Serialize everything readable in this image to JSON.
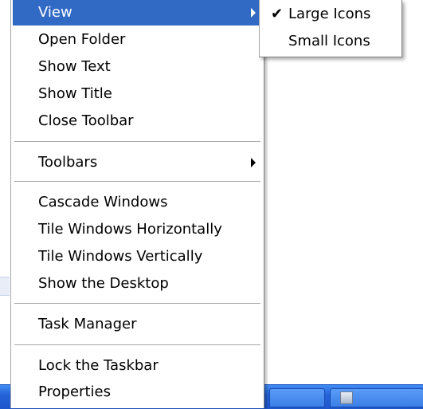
{
  "menu": {
    "items": [
      {
        "label": "View",
        "has_submenu": true,
        "selected": true
      },
      {
        "label": "Open Folder"
      },
      {
        "label": "Show Text"
      },
      {
        "label": "Show Title"
      },
      {
        "label": "Close Toolbar"
      },
      {
        "label": "Toolbars",
        "has_submenu": true
      },
      {
        "label": "Cascade Windows"
      },
      {
        "label": "Tile Windows Horizontally"
      },
      {
        "label": "Tile Windows Vertically"
      },
      {
        "label": "Show the Desktop"
      },
      {
        "label": "Task Manager"
      },
      {
        "label": "Lock the Taskbar"
      },
      {
        "label": "Properties"
      }
    ]
  },
  "submenu": {
    "items": [
      {
        "label": "Large Icons",
        "checked": true
      },
      {
        "label": "Small Icons",
        "checked": false
      }
    ]
  },
  "colors": {
    "highlight": "#316ac5",
    "taskbar": "#245edb"
  },
  "icons": {
    "check": "checkmark-icon",
    "submenu_arrow": "triangle-right-icon"
  }
}
